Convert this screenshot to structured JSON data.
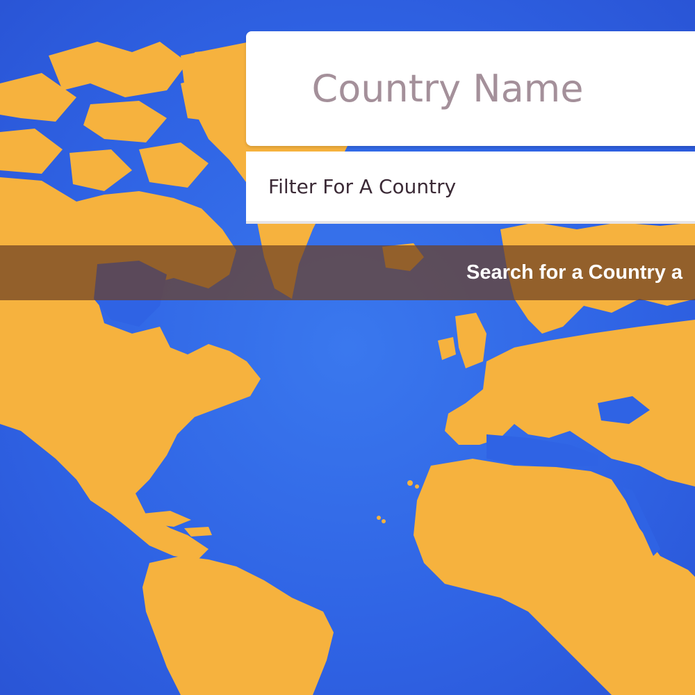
{
  "header": {
    "title": "Country Name"
  },
  "filter": {
    "placeholder": "Filter For A Country",
    "value": ""
  },
  "banner": {
    "text": "Search for a Country a"
  },
  "background": {
    "icon": "world-map",
    "ocean_color": "#2f63e4",
    "land_color": "#f6b23e"
  }
}
